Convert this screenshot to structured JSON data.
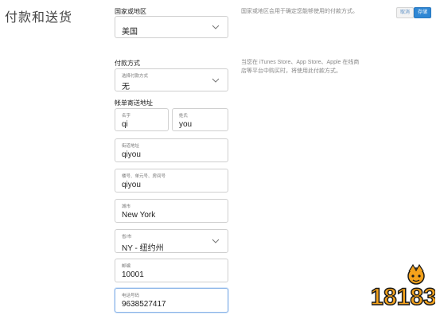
{
  "page": {
    "title": "付款和送货"
  },
  "actions": {
    "cancel_label": "取消",
    "save_label": "存储"
  },
  "country": {
    "label": "国家或地区",
    "value": "美国",
    "help": "国家或地区会用于确定您能够使用的付款方式。"
  },
  "payment": {
    "label": "付款方式",
    "field_label": "选择付款方式",
    "value": "无",
    "help": "当您在 iTunes Store、App Store、Apple 在线商店等平台中购买时，将使用此付款方式。"
  },
  "billing": {
    "label": "帐单寄送地址",
    "first_name": {
      "label": "名字",
      "value": "qi"
    },
    "last_name": {
      "label": "姓氏",
      "value": "you"
    },
    "street": {
      "label": "街道地址",
      "value": "qiyou"
    },
    "apt": {
      "label": "楼号、单元号、房间号",
      "value": "qiyou"
    },
    "city": {
      "label": "城市",
      "value": "New York"
    },
    "state": {
      "label": "省/市",
      "value": "NY - 纽约州"
    },
    "zip": {
      "label": "邮编",
      "value": "10001"
    },
    "phone": {
      "label": "电话号码",
      "value": "9638527417"
    }
  },
  "watermark": {
    "text": "18183"
  },
  "colors": {
    "accent": "#2f87d4",
    "logo_orange": "#f4a21b",
    "logo_dark": "#1a1a1a"
  }
}
